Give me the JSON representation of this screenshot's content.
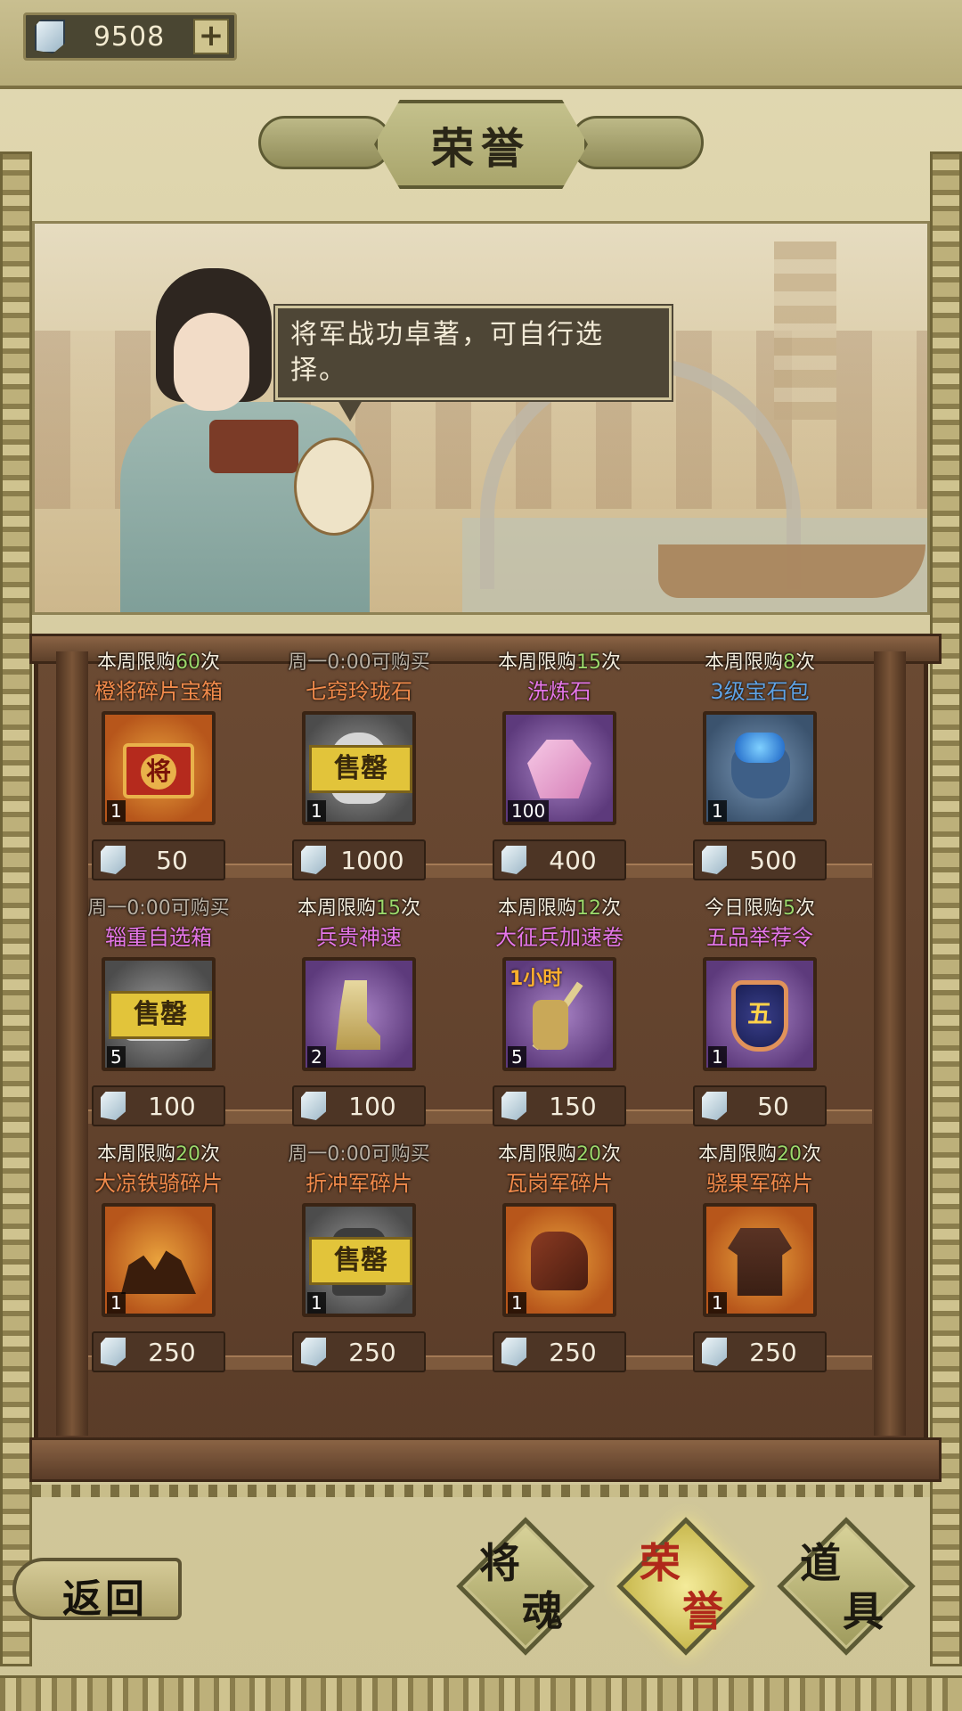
{
  "currency": {
    "value": "9508",
    "icon": "gem-icon"
  },
  "title": "荣誉",
  "dialogue": "将军战功卓著，可自行选择。",
  "colors": {
    "limit_count": "#9cd86b",
    "orange_name": "#f08a4b",
    "purple_name": "#e476e8",
    "blue_name": "#5fa3e6",
    "dim": "#b9b0a3"
  },
  "items": [
    {
      "limit_prefix": "本周限购",
      "limit_num": "60",
      "limit_suffix": "次",
      "name": "橙将碎片宝箱",
      "name_color": "#f08a4b",
      "rarity": "orange",
      "count": "1",
      "price": "50",
      "sold_out": "",
      "icon": "general-chest-icon",
      "badge": ""
    },
    {
      "limit_prefix": "周一0:00可购买",
      "limit_num": "",
      "limit_suffix": "",
      "name": "七窍玲珑石",
      "name_color": "#f08a4b",
      "rarity": "grey",
      "count": "1",
      "price": "1000",
      "sold_out": "售罄",
      "icon": "stone-icon",
      "badge": ""
    },
    {
      "limit_prefix": "本周限购",
      "limit_num": "15",
      "limit_suffix": "次",
      "name": "洗炼石",
      "name_color": "#e476e8",
      "rarity": "purple",
      "count": "100",
      "price": "400",
      "sold_out": "",
      "icon": "crystal-icon",
      "badge": ""
    },
    {
      "limit_prefix": "本周限购",
      "limit_num": "8",
      "limit_suffix": "次",
      "name": "3级宝石包",
      "name_color": "#5fa3e6",
      "rarity": "blue",
      "count": "1",
      "price": "500",
      "sold_out": "",
      "icon": "gem-bag-icon",
      "badge": ""
    },
    {
      "limit_prefix": "周一0:00可购买",
      "limit_num": "",
      "limit_suffix": "",
      "name": "辎重自选箱",
      "name_color": "#e476e8",
      "rarity": "grey",
      "count": "5",
      "price": "100",
      "sold_out": "售罄",
      "icon": "supply-box-icon",
      "badge": ""
    },
    {
      "limit_prefix": "本周限购",
      "limit_num": "15",
      "limit_suffix": "次",
      "name": "兵贵神速",
      "name_color": "#e476e8",
      "rarity": "purple",
      "count": "2",
      "price": "100",
      "sold_out": "",
      "icon": "boot-icon",
      "badge": ""
    },
    {
      "limit_prefix": "本周限购",
      "limit_num": "12",
      "limit_suffix": "次",
      "name": "大征兵加速卷",
      "name_color": "#e476e8",
      "rarity": "purple",
      "count": "5",
      "price": "150",
      "sold_out": "",
      "icon": "spear-soldier-icon",
      "badge": "1小时"
    },
    {
      "limit_prefix": "今日限购",
      "limit_num": "5",
      "limit_suffix": "次",
      "name": "五品举荐令",
      "name_color": "#e476e8",
      "rarity": "purple",
      "count": "1",
      "price": "50",
      "sold_out": "",
      "icon": "badge-five-icon",
      "badge": ""
    },
    {
      "limit_prefix": "本周限购",
      "limit_num": "20",
      "limit_suffix": "次",
      "name": "大凉铁骑碎片",
      "name_color": "#f08a4b",
      "rarity": "orange",
      "count": "1",
      "price": "250",
      "sold_out": "",
      "icon": "cavalry-icon",
      "badge": ""
    },
    {
      "limit_prefix": "周一0:00可购买",
      "limit_num": "",
      "limit_suffix": "",
      "name": "折冲军碎片",
      "name_color": "#f08a4b",
      "rarity": "grey",
      "count": "1",
      "price": "250",
      "sold_out": "售罄",
      "icon": "armor-icon",
      "badge": ""
    },
    {
      "limit_prefix": "本周限购",
      "limit_num": "20",
      "limit_suffix": "次",
      "name": "瓦岗军碎片",
      "name_color": "#f08a4b",
      "rarity": "orange",
      "count": "1",
      "price": "250",
      "sold_out": "",
      "icon": "gauntlet-icon",
      "badge": ""
    },
    {
      "limit_prefix": "本周限购",
      "limit_num": "20",
      "limit_suffix": "次",
      "name": "骁果军碎片",
      "name_color": "#f08a4b",
      "rarity": "orange",
      "count": "1",
      "price": "250",
      "sold_out": "",
      "icon": "tunic-icon",
      "badge": ""
    }
  ],
  "nav": {
    "back": "返回",
    "tabs": [
      {
        "c1": "将",
        "c2": "魂",
        "active": false
      },
      {
        "c1": "荣",
        "c2": "誉",
        "active": true
      },
      {
        "c1": "道",
        "c2": "具",
        "active": false
      }
    ]
  }
}
